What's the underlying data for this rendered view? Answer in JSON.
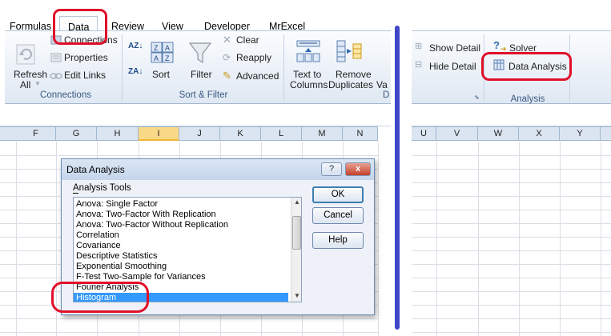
{
  "left": {
    "tabs": [
      {
        "label": "Formulas",
        "active": false
      },
      {
        "label": "Data",
        "active": true
      },
      {
        "label": "Review",
        "active": false
      },
      {
        "label": "View",
        "active": false
      },
      {
        "label": "Developer",
        "active": false
      },
      {
        "label": "MrExcel",
        "active": false
      }
    ],
    "connections": {
      "refresh_label": "Refresh",
      "refresh_all_label": "All",
      "connections_label": "Connections",
      "properties_label": "Properties",
      "edit_links_label": "Edit Links",
      "group_label": "Connections"
    },
    "sort_filter": {
      "sort_az_label": "AZ",
      "sort_za_label": "ZA",
      "sort_label": "Sort",
      "filter_label": "Filter",
      "clear_label": "Clear",
      "reapply_label": "Reapply",
      "advanced_label": "Advanced",
      "group_label": "Sort & Filter"
    },
    "data_tools": {
      "text_to_columns_line1": "Text to",
      "text_to_columns_line2": "Columns",
      "remove_duplicates_line1": "Remove",
      "remove_duplicates_line2": "Duplicates",
      "truncated_label": "Va",
      "group_label_truncated": "D"
    },
    "columns": [
      "F",
      "G",
      "H",
      "I",
      "J",
      "K",
      "L",
      "M",
      "N"
    ],
    "selected_column": "I"
  },
  "dialog": {
    "title": "Data Analysis",
    "help_button": "?",
    "close_button": "x",
    "tools_label": "Analysis Tools",
    "tools_label_accesskey": "A",
    "items": [
      "Anova: Single Factor",
      "Anova: Two-Factor With Replication",
      "Anova: Two-Factor Without Replication",
      "Correlation",
      "Covariance",
      "Descriptive Statistics",
      "Exponential Smoothing",
      "F-Test Two-Sample for Variances",
      "Fourier Analysis",
      "Histogram"
    ],
    "selected_item": "Histogram",
    "ok_label": "OK",
    "cancel_label": "Cancel",
    "help_label": "Help"
  },
  "right": {
    "show_detail_label": "Show Detail",
    "hide_detail_label": "Hide Detail",
    "solver_label": "Solver",
    "data_analysis_label": "Data Analysis",
    "group_label": "Analysis",
    "columns": [
      "U",
      "V",
      "W",
      "X",
      "Y"
    ]
  },
  "colors": {
    "annotation_red": "#e0102a",
    "divider_blue": "#4046c8",
    "selection_blue": "#3399ff"
  }
}
